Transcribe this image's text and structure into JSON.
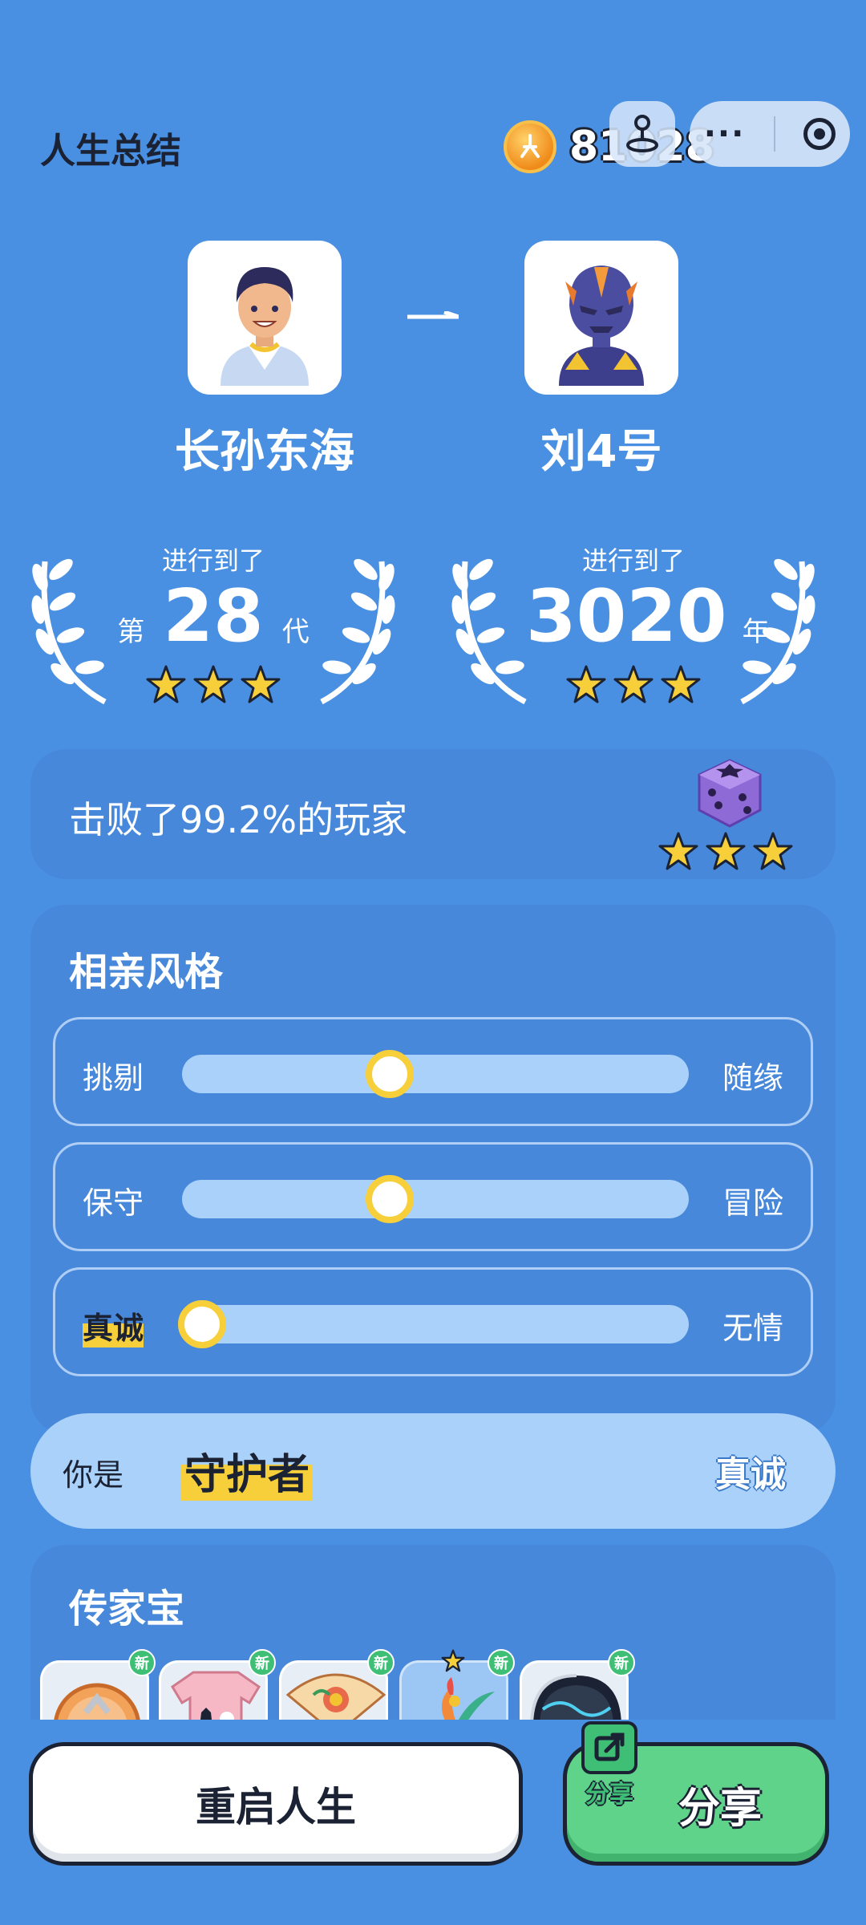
{
  "header": {
    "title": "人生总结",
    "coin_icon": "coin-icon",
    "coin_count": "81028"
  },
  "avatars": {
    "from_name": "长孙东海",
    "to_name": "刘4号"
  },
  "progress": {
    "generation": {
      "caption": "进行到了",
      "prefix": "第",
      "value": "28",
      "unit": "代",
      "stars": 3
    },
    "year": {
      "caption": "进行到了",
      "value": "3020",
      "unit": "年",
      "stars": 3
    }
  },
  "ranking": {
    "text": "击败了99.2%的玩家",
    "stars": 3
  },
  "style": {
    "title": "相亲风格",
    "sliders": [
      {
        "left": "挑剔",
        "right": "随缘",
        "value": 0.41,
        "left_highlight": false
      },
      {
        "left": "保守",
        "right": "冒险",
        "value": 0.41,
        "left_highlight": false
      },
      {
        "left": "真诚",
        "right": "无情",
        "value": 0.04,
        "left_highlight": true
      }
    ]
  },
  "result": {
    "prefix": "你是",
    "role": "守护者",
    "trait": "真诚"
  },
  "heirloom": {
    "title": "传家宝",
    "badge_label": "新",
    "items": [
      {
        "name": "medal",
        "new": true
      },
      {
        "name": "cat-tshirt",
        "new": true
      },
      {
        "name": "folding-fan",
        "new": true
      },
      {
        "name": "feather-ornament",
        "new": true,
        "selected": true
      },
      {
        "name": "helmet",
        "new": true
      }
    ]
  },
  "actions": {
    "restart_label": "重启人生",
    "share_label": "分享",
    "share_badge_label": "分享"
  },
  "colors": {
    "background": "#4a90e2",
    "card": "#4788da",
    "accent_yellow": "#f6cf3a",
    "accent_green": "#5fd38a",
    "track": "#a9d1fa"
  }
}
